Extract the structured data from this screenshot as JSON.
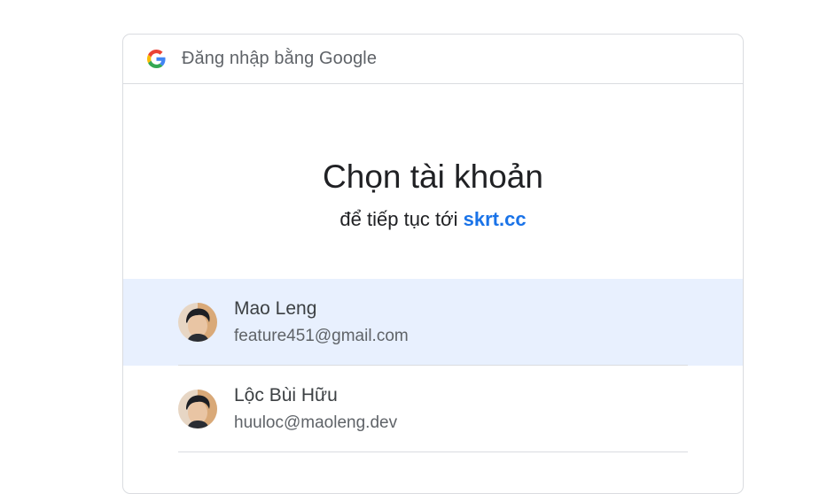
{
  "header": {
    "title": "Đăng nhập bằng Google",
    "logo_icon": "google-g-icon"
  },
  "main": {
    "title": "Chọn tài khoản",
    "subtitle_prefix": "để tiếp tục tới",
    "site": "skrt.cc"
  },
  "accounts": [
    {
      "name": "Mao Leng",
      "email": "feature451@gmail.com",
      "selected": true
    },
    {
      "name": "Lộc Bùi Hữu",
      "email": "huuloc@maoleng.dev",
      "selected": false
    }
  ],
  "colors": {
    "accent": "#1a73e8",
    "selected_bg": "#e8f0fe",
    "border": "#dadce0"
  }
}
